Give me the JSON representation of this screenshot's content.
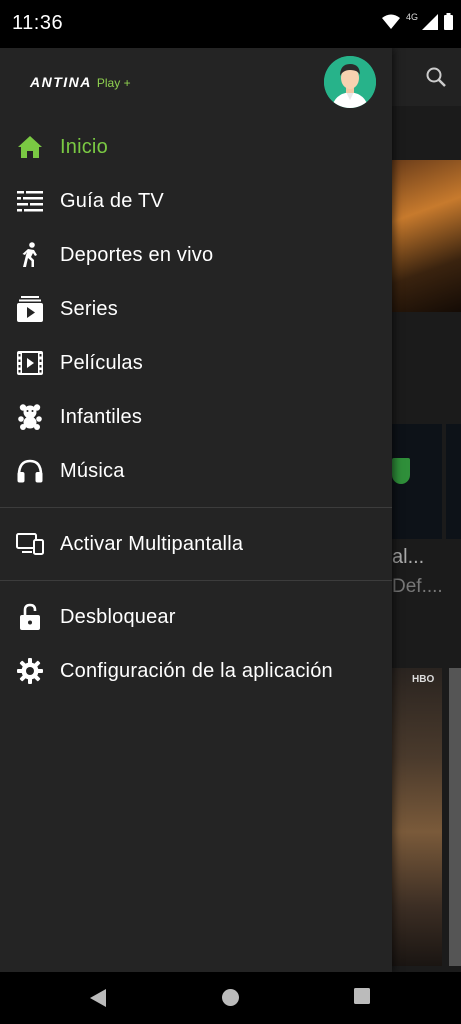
{
  "status_bar": {
    "time": "11:36",
    "network": "4G"
  },
  "app": {
    "brand": "ANTINA",
    "brand_suffix": "Play +"
  },
  "menu": {
    "items": [
      {
        "label": "Inicio",
        "icon": "home-icon",
        "active": true
      },
      {
        "label": "Guía de TV",
        "icon": "tv-guide-icon"
      },
      {
        "label": "Deportes en vivo",
        "icon": "running-icon"
      },
      {
        "label": "Series",
        "icon": "series-icon"
      },
      {
        "label": "Películas",
        "icon": "film-icon"
      },
      {
        "label": "Infantiles",
        "icon": "teddy-bear-icon"
      },
      {
        "label": "Música",
        "icon": "headphones-icon"
      }
    ],
    "section2": [
      {
        "label": "Activar Multipantalla",
        "icon": "multiscreen-icon"
      }
    ],
    "section3": [
      {
        "label": "Desbloquear",
        "icon": "unlock-icon"
      },
      {
        "label": "Configuración de la aplicación",
        "icon": "gear-icon"
      }
    ]
  },
  "background": {
    "text1": "al...",
    "text2": "Def....",
    "badge": "HBO"
  },
  "colors": {
    "accent": "#7ac943",
    "drawer": "#242424",
    "avatar_bg": "#27b38a"
  }
}
